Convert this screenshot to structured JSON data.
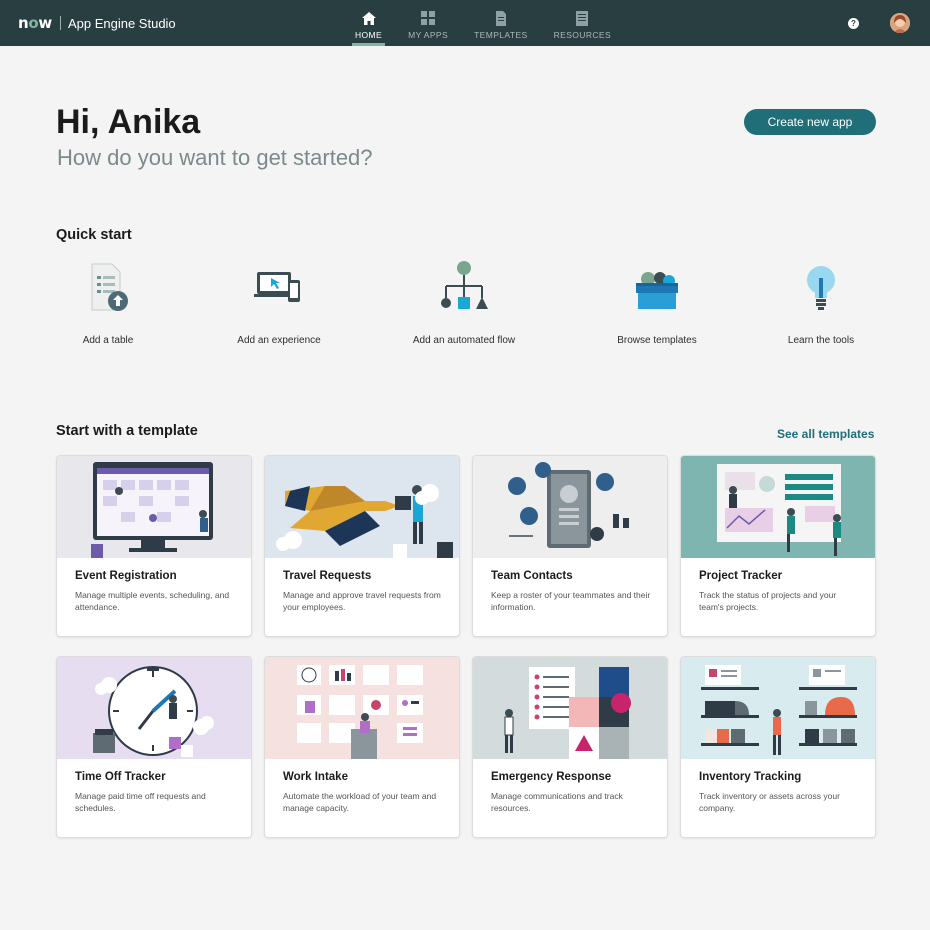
{
  "header": {
    "logo": "now",
    "app_name": "App Engine Studio",
    "nav": [
      {
        "label": "HOME",
        "icon": "home-icon",
        "active": true
      },
      {
        "label": "MY APPS",
        "icon": "grid-icon",
        "active": false
      },
      {
        "label": "TEMPLATES",
        "icon": "document-icon",
        "active": false
      },
      {
        "label": "RESOURCES",
        "icon": "book-icon",
        "active": false
      }
    ],
    "help": "?"
  },
  "hero": {
    "greeting": "Hi, Anika",
    "subtitle": "How do you want to get started?",
    "create_button": "Create new app"
  },
  "quick_start": {
    "title": "Quick start",
    "items": [
      {
        "label": "Add a table",
        "icon": "table-upload-icon"
      },
      {
        "label": "Add an experience",
        "icon": "devices-icon"
      },
      {
        "label": "Add an automated flow",
        "icon": "flow-icon"
      },
      {
        "label": "Browse templates",
        "icon": "templates-box-icon"
      },
      {
        "label": "Learn the tools",
        "icon": "lightbulb-icon"
      }
    ]
  },
  "templates": {
    "title": "Start with a template",
    "see_all": "See all templates",
    "cards": [
      {
        "title": "Event Registration",
        "desc": "Manage multiple events, scheduling, and attendance.",
        "bg": "#e6e6ea"
      },
      {
        "title": "Travel Requests",
        "desc": "Manage and approve travel requests from your employees.",
        "bg": "#dde6ef"
      },
      {
        "title": "Team Contacts",
        "desc": "Keep a roster of your teammates and their information.",
        "bg": "#eeeeee"
      },
      {
        "title": "Project Tracker",
        "desc": "Track the status of projects and your team's projects.",
        "bg": "#7fb5b0"
      },
      {
        "title": "Time Off Tracker",
        "desc": "Manage paid time off requests and schedules.",
        "bg": "#e6def0"
      },
      {
        "title": "Work Intake",
        "desc": "Automate the workload of your team and manage capacity.",
        "bg": "#f6e1e1"
      },
      {
        "title": "Emergency Response",
        "desc": "Manage communications and track resources.",
        "bg": "#d4dbdc"
      },
      {
        "title": "Inventory Tracking",
        "desc": "Track inventory or assets across your company.",
        "bg": "#d8ecef"
      }
    ]
  }
}
